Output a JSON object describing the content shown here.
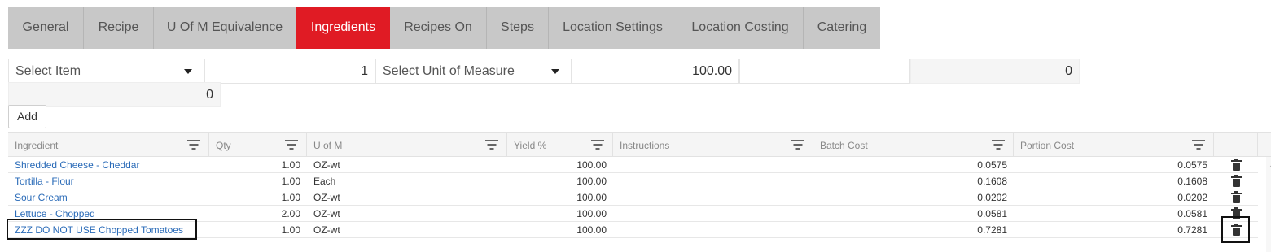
{
  "tabs": [
    {
      "label": "General",
      "active": false
    },
    {
      "label": "Recipe",
      "active": false
    },
    {
      "label": "U Of M Equivalence",
      "active": false
    },
    {
      "label": "Ingredients",
      "active": true
    },
    {
      "label": "Recipes On",
      "active": false
    },
    {
      "label": "Steps",
      "active": false
    },
    {
      "label": "Location Settings",
      "active": false
    },
    {
      "label": "Location Costing",
      "active": false
    },
    {
      "label": "Catering",
      "active": false
    }
  ],
  "form": {
    "item_select": "Select Item",
    "qty": "1",
    "uom_select": "Select Unit of Measure",
    "yield": "100.00",
    "instructions": "",
    "batch_cost": "0",
    "portion_cost": "0",
    "add_label": "Add"
  },
  "grid": {
    "columns": [
      "Ingredient",
      "Qty",
      "U of M",
      "Yield %",
      "Instructions",
      "Batch Cost",
      "Portion Cost"
    ],
    "rows": [
      {
        "ingredient": "Shredded Cheese - Cheddar",
        "qty": "1.00",
        "uom": "OZ-wt",
        "yield": "100.00",
        "instructions": "",
        "batch_cost": "0.0575",
        "portion_cost": "0.0575"
      },
      {
        "ingredient": "Tortilla - Flour",
        "qty": "1.00",
        "uom": "Each",
        "yield": "100.00",
        "instructions": "",
        "batch_cost": "0.1608",
        "portion_cost": "0.1608"
      },
      {
        "ingredient": "Sour Cream",
        "qty": "1.00",
        "uom": "OZ-wt",
        "yield": "100.00",
        "instructions": "",
        "batch_cost": "0.0202",
        "portion_cost": "0.0202"
      },
      {
        "ingredient": "Lettuce - Chopped",
        "qty": "2.00",
        "uom": "OZ-wt",
        "yield": "100.00",
        "instructions": "",
        "batch_cost": "0.0581",
        "portion_cost": "0.0581"
      },
      {
        "ingredient": "ZZZ DO NOT USE Chopped Tomatoes",
        "qty": "1.00",
        "uom": "OZ-wt",
        "yield": "100.00",
        "instructions": "",
        "batch_cost": "0.7281",
        "portion_cost": "0.7281"
      }
    ]
  },
  "colors": {
    "accent": "#e01b24",
    "link": "#2a6bb8",
    "tab_bg": "#c8c8c8"
  },
  "icons": {
    "dropdown": "chevron-down-icon",
    "filter": "filter-icon",
    "delete": "trash-icon"
  }
}
